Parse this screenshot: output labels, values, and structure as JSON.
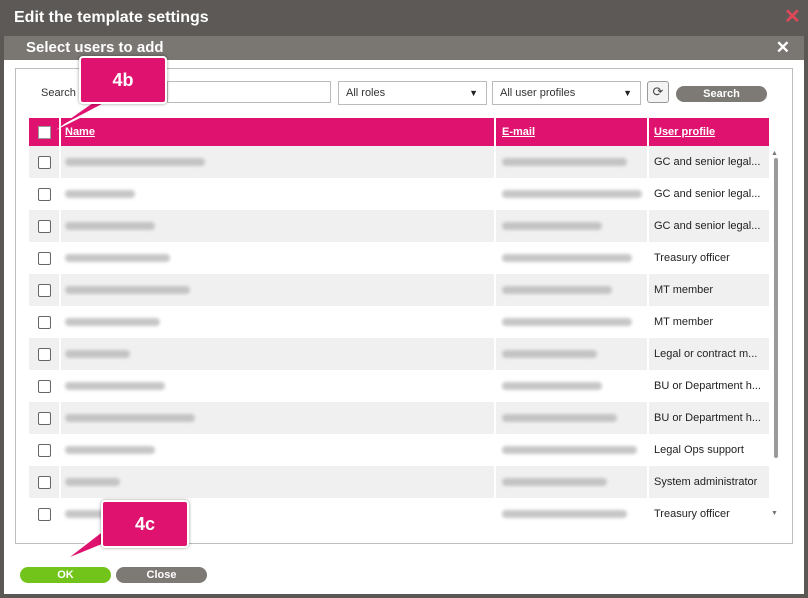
{
  "window": {
    "title": "Edit the template settings",
    "close_glyph": "✕"
  },
  "dialog": {
    "title": "Select users to add",
    "close_glyph": "✕"
  },
  "filters": {
    "search_label": "Search",
    "search_value": "",
    "roles_select": "All roles",
    "profiles_select": "All user profiles",
    "refresh_glyph": "⟳",
    "search_button": "Search"
  },
  "table": {
    "columns": [
      "Name",
      "E-mail",
      "User profile"
    ],
    "rows": [
      {
        "profile": "GC and senior legal..."
      },
      {
        "profile": "GC and senior legal..."
      },
      {
        "profile": "GC and senior legal..."
      },
      {
        "profile": "Treasury officer"
      },
      {
        "profile": "MT member"
      },
      {
        "profile": "MT member"
      },
      {
        "profile": "Legal or contract m..."
      },
      {
        "profile": "BU or Department h..."
      },
      {
        "profile": "BU or Department h..."
      },
      {
        "profile": "Legal Ops support"
      },
      {
        "profile": "System administrator"
      },
      {
        "profile": "Treasury officer"
      }
    ]
  },
  "footer": {
    "ok_button": "OK",
    "close_button": "Close"
  },
  "callouts": {
    "c4b": "4b",
    "c4c": "4c"
  },
  "colors": {
    "accent": "#e0126f",
    "ok": "#72c41a",
    "neutral_button": "#7d7975",
    "title_bar": "#5c5956"
  }
}
